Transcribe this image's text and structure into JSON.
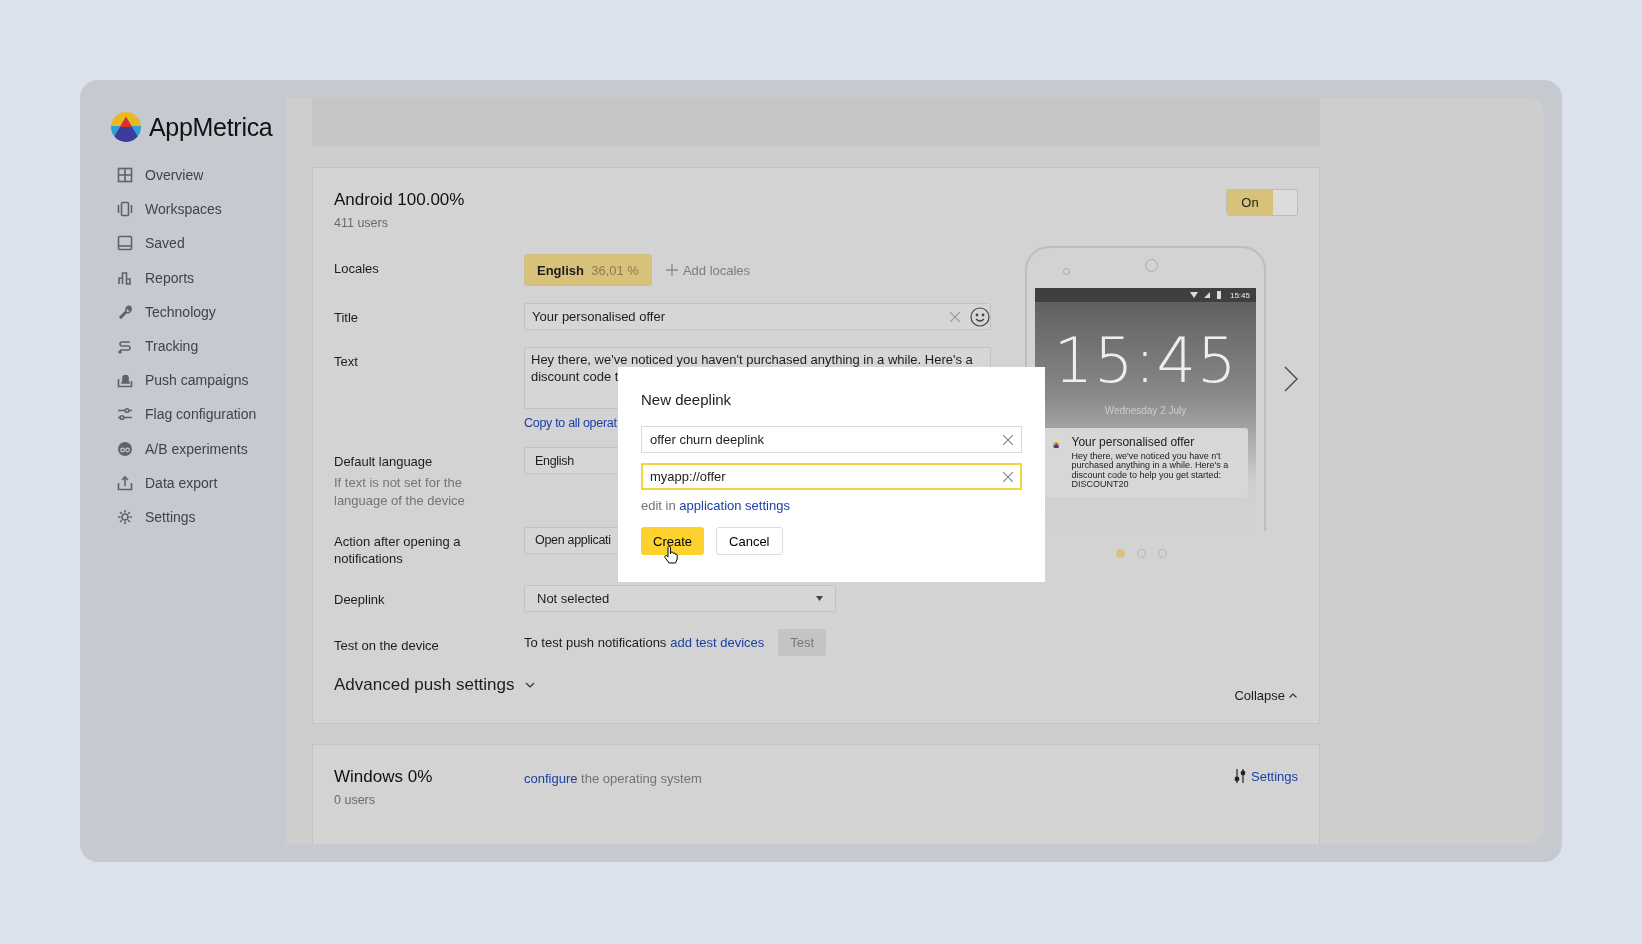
{
  "app": {
    "name": "AppMetrica"
  },
  "sidebar": {
    "items": [
      {
        "label": "Overview"
      },
      {
        "label": "Workspaces"
      },
      {
        "label": "Saved"
      },
      {
        "label": "Reports"
      },
      {
        "label": "Technology"
      },
      {
        "label": "Tracking"
      },
      {
        "label": "Push campaigns"
      },
      {
        "label": "Flag configuration"
      },
      {
        "label": "A/B experiments"
      },
      {
        "label": "Data export"
      },
      {
        "label": "Settings"
      }
    ]
  },
  "android": {
    "title": "Android 100.00%",
    "users": "411 users",
    "toggle": {
      "label": "On",
      "on": true
    },
    "locales": {
      "label": "Locales",
      "chips": [
        {
          "name": "English",
          "share": "36,01 %",
          "selected": true
        }
      ],
      "add": "Add locales"
    },
    "title_field": {
      "label": "Title",
      "value": "Your personalised offer"
    },
    "text_field": {
      "label": "Text",
      "value": "Hey there, we've noticed you haven't purchased anything in a while. Here's a discount code t",
      "copy_link": "Copy to all operat"
    },
    "default_language": {
      "label": "Default language",
      "hint": "If text is not set for the language of the device",
      "value": "English"
    },
    "action": {
      "label": "Action after opening a notifications",
      "value": "Open applicati"
    },
    "deeplink": {
      "label": "Deeplink",
      "value": "Not selected"
    },
    "test": {
      "label": "Test on the device",
      "text": "To test push notifications",
      "link": "add test devices",
      "button": "Test",
      "button_disabled": true
    },
    "advanced": {
      "label": "Advanced push settings",
      "expanded": false
    },
    "collapse": "Collapse",
    "preview": {
      "status_time": "15:45",
      "clock": "15:45",
      "date": "Wednesday 2 July",
      "notification_title": "Your personalised offer",
      "notification_text": "Hey there, we've noticed you have n't purchased anything in a while. Here's a discount code to help you get started: DISCOUNT20",
      "pages": [
        {
          "selected": true
        },
        {
          "selected": false
        },
        {
          "selected": false
        }
      ]
    }
  },
  "windows": {
    "title": "Windows 0%",
    "users": "0 users",
    "link": "configure",
    "text": "the operating system",
    "settings": "Settings"
  },
  "modal": {
    "title": "New deeplink",
    "name_value": "offer churn deeplink",
    "url_value": "myapp://offer",
    "url_focused": true,
    "hint": "edit in",
    "hint_link": "application settings",
    "create": "Create",
    "cancel": "Cancel"
  }
}
